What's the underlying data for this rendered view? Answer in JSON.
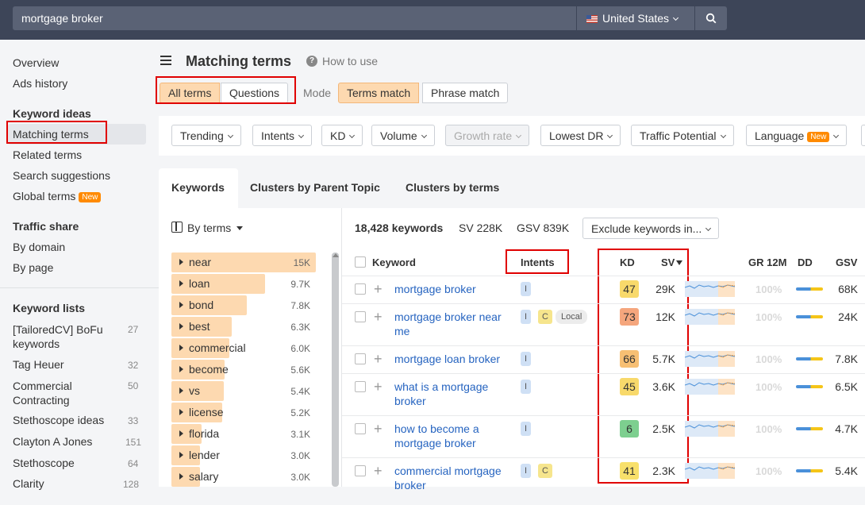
{
  "search": {
    "query": "mortgage broker",
    "country": "United States"
  },
  "sidebar": {
    "overview": "Overview",
    "ads_history": "Ads history",
    "keyword_ideas_heading": "Keyword ideas",
    "matching_terms": "Matching terms",
    "related_terms": "Related terms",
    "search_suggestions": "Search suggestions",
    "global_terms": "Global terms",
    "new_badge": "New",
    "traffic_share_heading": "Traffic share",
    "by_domain": "By domain",
    "by_page": "By page",
    "keyword_lists_heading": "Keyword lists",
    "lists": [
      {
        "name": "[TailoredCV] BoFu",
        "name2": "keywords",
        "count": "27"
      },
      {
        "name": "Tag Heuer",
        "count": "32"
      },
      {
        "name": "Commercial",
        "name2": "Contracting",
        "count": "50"
      },
      {
        "name": "Stethoscope ideas",
        "count": "33"
      },
      {
        "name": "Clayton A Jones",
        "count": "151"
      },
      {
        "name": "Stethoscope",
        "count": "64"
      },
      {
        "name": "Clarity",
        "count": "128"
      }
    ]
  },
  "header": {
    "title": "Matching terms",
    "how_to_use": "How to use"
  },
  "mode": {
    "all_terms": "All terms",
    "questions": "Questions",
    "label": "Mode",
    "terms_match": "Terms match",
    "phrase_match": "Phrase match"
  },
  "filters": {
    "trending": "Trending",
    "intents": "Intents",
    "kd": "KD",
    "volume": "Volume",
    "growth_rate": "Growth rate",
    "lowest_dr": "Lowest DR",
    "traffic_potential": "Traffic Potential",
    "language": "Language",
    "new_badge": "New"
  },
  "tabs": {
    "keywords": "Keywords",
    "clusters_parent": "Clusters by Parent Topic",
    "clusters_terms": "Clusters by terms"
  },
  "terms_panel": {
    "by_terms": "By terms",
    "terms": [
      {
        "term": "near",
        "count": "15K",
        "bar": 1.0
      },
      {
        "term": "loan",
        "count": "9.7K",
        "bar": 0.65
      },
      {
        "term": "bond",
        "count": "7.8K",
        "bar": 0.52
      },
      {
        "term": "best",
        "count": "6.3K",
        "bar": 0.42
      },
      {
        "term": "commercial",
        "count": "6.0K",
        "bar": 0.4
      },
      {
        "term": "become",
        "count": "5.6K",
        "bar": 0.37
      },
      {
        "term": "vs",
        "count": "5.4K",
        "bar": 0.36
      },
      {
        "term": "license",
        "count": "5.2K",
        "bar": 0.35
      },
      {
        "term": "florida",
        "count": "3.1K",
        "bar": 0.21
      },
      {
        "term": "lender",
        "count": "3.0K",
        "bar": 0.2
      },
      {
        "term": "salary",
        "count": "3.0K",
        "bar": 0.2
      }
    ]
  },
  "summary": {
    "keywords": "18,428 keywords",
    "sv": "SV 228K",
    "gsv": "GSV 839K",
    "exclude": "Exclude keywords in..."
  },
  "table": {
    "headers": {
      "keyword": "Keyword",
      "intents": "Intents",
      "kd": "KD",
      "sv": "SV",
      "gr": "GR 12M",
      "dd": "DD",
      "gsv": "GSV"
    },
    "gr_value": "100%",
    "rows": [
      {
        "keyword": "mortgage broker",
        "intents": [
          "I"
        ],
        "kd": "47",
        "kd_color": "#f8d96b",
        "sv": "29K",
        "gsv": "68K"
      },
      {
        "keyword": "mortgage broker near me",
        "intents": [
          "I",
          "C",
          "Local"
        ],
        "kd": "73",
        "kd_color": "#f5a67d",
        "sv": "12K",
        "gsv": "24K"
      },
      {
        "keyword": "mortgage loan broker",
        "intents": [
          "I"
        ],
        "kd": "66",
        "kd_color": "#f7bf73",
        "sv": "5.7K",
        "gsv": "7.8K"
      },
      {
        "keyword": "what is a mortgage broker",
        "intents": [
          "I"
        ],
        "kd": "45",
        "kd_color": "#f8d96b",
        "sv": "3.6K",
        "gsv": "6.5K"
      },
      {
        "keyword": "how to become a mortgage broker",
        "intents": [
          "I"
        ],
        "kd": "6",
        "kd_color": "#7dcf8f",
        "sv": "2.5K",
        "gsv": "4.7K"
      },
      {
        "keyword": "commercial mortgage broker",
        "intents": [
          "I",
          "C"
        ],
        "kd": "41",
        "kd_color": "#f8e06b",
        "sv": "2.3K",
        "gsv": "5.4K"
      }
    ]
  }
}
